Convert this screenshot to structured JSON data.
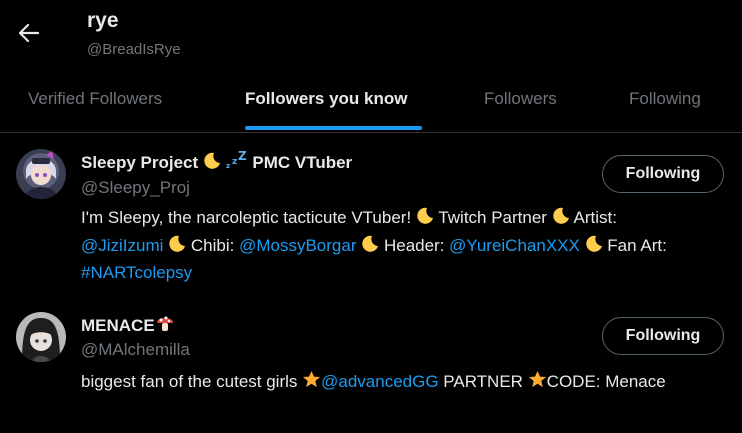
{
  "header": {
    "name": "rye",
    "handle": "@BreadIsRye"
  },
  "tabs": [
    {
      "label": "Verified Followers",
      "active": false
    },
    {
      "label": "Followers you know",
      "active": true
    },
    {
      "label": "Followers",
      "active": false
    },
    {
      "label": "Following",
      "active": false
    }
  ],
  "users": [
    {
      "name": "Sleepy Project",
      "name_suffix": "PMC VTuber",
      "handle": "@Sleepy_Proj",
      "follow_label": "Following",
      "bio": {
        "t1": "I'm Sleepy, the narcoleptic tacticute VTuber! ",
        "t2": " Twitch Partner ",
        "t3": " Artist:",
        "link1": "@JiziIzumi",
        "t4": " Chibi: ",
        "link2": "@MossyBorgar",
        "t5": " Header: ",
        "link3": "@YureiChanXXX",
        "t6": " Fan Art: ",
        "link4": "#NARTcolepsy"
      }
    },
    {
      "name": "MENACE",
      "handle": "@MAlchemilla",
      "follow_label": "Following",
      "bio": {
        "t1": "biggest fan of the cutest girls ",
        "link1": "@advancedGG",
        "t2": " PARTNER ",
        "t3": "CODE: Menace"
      }
    }
  ],
  "colors": {
    "background": "#000000",
    "text": "#e7e9ea",
    "secondary": "#71767b",
    "accent": "#1d9bf0",
    "divider": "#2f3336"
  },
  "icons": {
    "back": "arrow-left-icon",
    "moon": "crescent-moon-emoji",
    "zzz": "zzz-emoji",
    "mushroom": "mushroom-emoji",
    "star": "star-emoji"
  }
}
